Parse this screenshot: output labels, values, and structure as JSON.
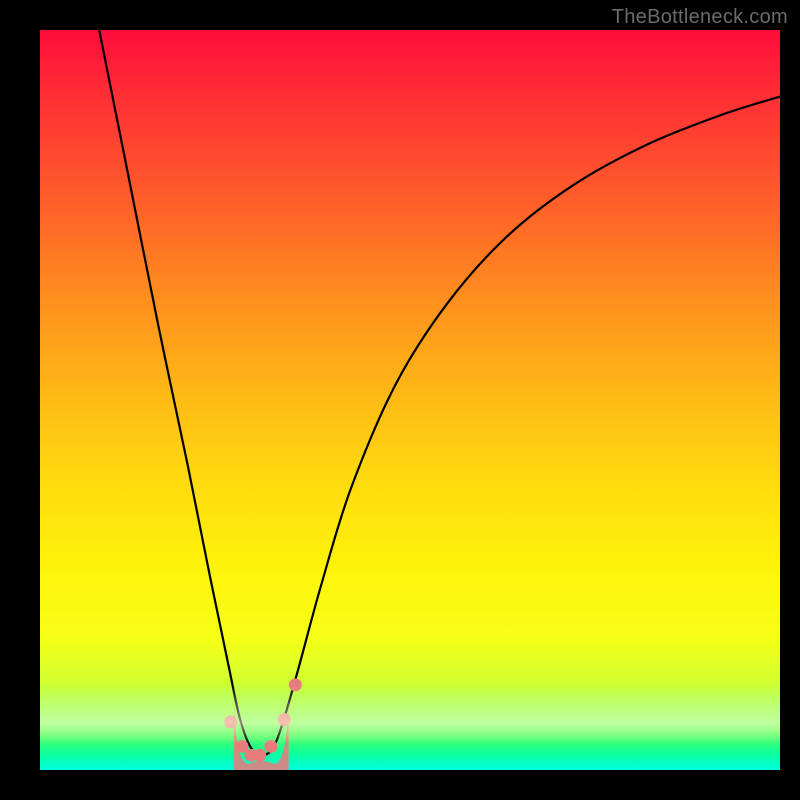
{
  "watermark": "TheBottleneck.com",
  "chart_data": {
    "type": "line",
    "title": "",
    "xlabel": "",
    "ylabel": "",
    "xlim": [
      0,
      100
    ],
    "ylim": [
      0,
      100
    ],
    "series": [
      {
        "name": "bottleneck-curve",
        "x": [
          8,
          12,
          16,
          20,
          23,
          25.5,
          27,
          28.5,
          30,
          31.5,
          33,
          35,
          38,
          42,
          48,
          55,
          63,
          72,
          82,
          92,
          100
        ],
        "y": [
          100,
          80,
          60,
          41,
          26,
          14,
          7,
          3,
          2,
          3,
          7,
          14,
          25,
          38,
          52,
          63,
          72,
          79,
          84.5,
          88.5,
          91
        ]
      }
    ],
    "markers": {
      "name": "valley-dots",
      "color": "#e77c7c",
      "x": [
        25.8,
        27.3,
        28.5,
        29.7,
        31.2,
        33.0,
        34.5
      ],
      "y": [
        6.5,
        3.2,
        2.0,
        2.0,
        3.2,
        6.8,
        11.5
      ]
    },
    "valley_fill": {
      "color": "#e77c7c",
      "x": [
        26.2,
        33.6
      ],
      "base_y": 0
    },
    "gradient_stops": [
      {
        "pos": 0.0,
        "c": "#ff0c3a"
      },
      {
        "pos": 0.22,
        "c": "#ff5a2b"
      },
      {
        "pos": 0.48,
        "c": "#ffb516"
      },
      {
        "pos": 0.72,
        "c": "#fff20a"
      },
      {
        "pos": 0.92,
        "c": "#95ff4a"
      },
      {
        "pos": 1.0,
        "c": "#02ffe0"
      }
    ]
  }
}
